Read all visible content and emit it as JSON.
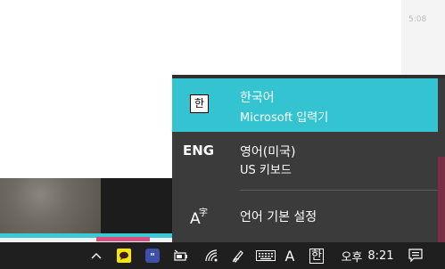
{
  "background": {
    "time_hint": "5:08"
  },
  "ime_menu": {
    "items": [
      {
        "abbr": "한",
        "name": "한국어",
        "sub": "Microsoft 입력기",
        "selected": true
      },
      {
        "abbr": "ENG",
        "name": "영어(미국)",
        "sub": "US 키보드",
        "selected": false
      }
    ],
    "settings_label": "언어 기본 설정",
    "settings_icon_big": "A",
    "settings_icon_small": "字"
  },
  "taskbar": {
    "lang_letter": "A",
    "ime_mode": "한",
    "ampm": "오후",
    "time": "8:21"
  },
  "colors": {
    "accent": "#33c3d1",
    "popup_bg": "#3b3b3b",
    "taskbar_bg": "#1f1f1f",
    "kakao_yellow": "#f7e600",
    "notion_blue": "#3d4fa8"
  },
  "icons": [
    "chevron-up-icon",
    "kakaotalk-icon",
    "quote-app-icon",
    "battery-icon",
    "wifi-icon",
    "pen-icon",
    "keyboard-icon",
    "notification-icon"
  ]
}
